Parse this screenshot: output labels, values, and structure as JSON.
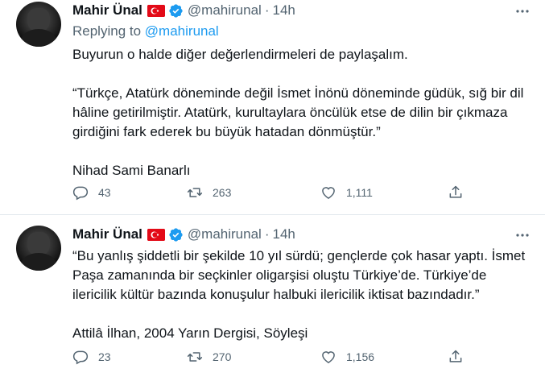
{
  "tweets": [
    {
      "author_name": "Mahir Ünal",
      "handle": "@mahirunal",
      "separator": "·",
      "time": "14h",
      "replying_prefix": "Replying to",
      "replying_to": "@mahirunal",
      "paragraphs": [
        "Buyurun o halde diğer değerlendirmeleri de paylaşalım.",
        "“Türkçe, Atatürk döneminde değil İsmet İnönü döneminde güdük, sığ bir dil hâline getirilmiştir. Atatürk, kurultaylara öncülük etse de dilin bir çıkmaza girdiğini fark ederek bu büyük hatadan dönmüştür.”",
        "Nihad Sami Banarlı"
      ],
      "replies": "43",
      "retweets": "263",
      "likes": "1,111"
    },
    {
      "author_name": "Mahir Ünal",
      "handle": "@mahirunal",
      "separator": "·",
      "time": "14h",
      "paragraphs": [
        "“Bu yanlış şiddetli bir şekilde 10 yıl sürdü; gençlerde çok hasar yaptı. İsmet Paşa zamanında bir seçkinler oligarşisi oluştu Türkiye’de. Türkiye’de ilericilik kültür bazında konuşulur halbuki ilericilik iktisat bazındadır.”",
        "Attilâ İlhan, 2004 Yarın Dergisi, Söyleşi"
      ],
      "replies": "23",
      "retweets": "270",
      "likes": "1,156"
    }
  ],
  "icons": {
    "reply": "reply-icon",
    "retweet": "retweet-icon",
    "like": "heart-icon",
    "share": "share-icon",
    "more": "more-icon",
    "verified": "verified-badge-icon",
    "flag": "turkey-flag-icon"
  },
  "colors": {
    "accent": "#1d9bf0",
    "secondary_text": "#536471",
    "flag_red": "#e30a17"
  }
}
